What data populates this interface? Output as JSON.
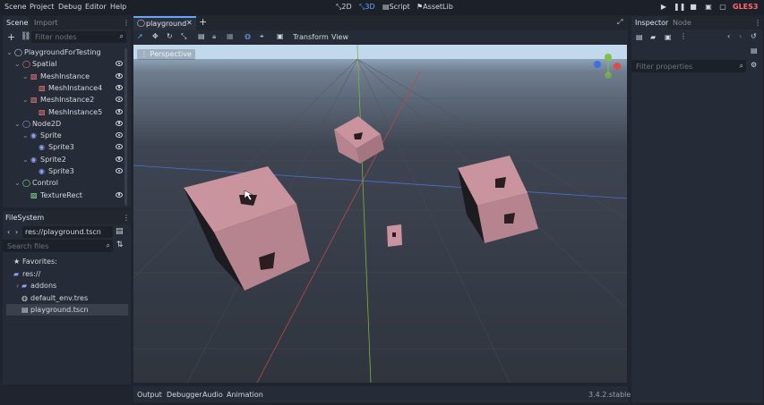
{
  "menu": [
    "Scene",
    "Project",
    "Debug",
    "Editor",
    "Help"
  ],
  "modes": [
    {
      "label": "2D",
      "icon": "2d-icon",
      "active": false
    },
    {
      "label": "3D",
      "icon": "3d-icon",
      "active": true
    },
    {
      "label": "Script",
      "icon": "script-icon",
      "active": false
    },
    {
      "label": "AssetLib",
      "icon": "assetlib-icon",
      "active": false
    }
  ],
  "renderer": "GLES3",
  "scene_dock": {
    "tabs": [
      "Scene",
      "Import"
    ],
    "filter_placeholder": "Filter nodes",
    "tree": [
      {
        "label": "PlaygroundForTesting",
        "depth": 0,
        "icon": "node3d-root-icon",
        "color": "#d4d7dc",
        "eye": false
      },
      {
        "label": "Spatial",
        "depth": 1,
        "icon": "spatial-icon",
        "color": "#fc7f7f",
        "eye": true
      },
      {
        "label": "MeshInstance",
        "depth": 2,
        "icon": "meshinstance-icon",
        "color": "#fc7f7f",
        "eye": true
      },
      {
        "label": "MeshInstance4",
        "depth": 3,
        "icon": "meshinstance-icon",
        "color": "#fc7f7f",
        "eye": true
      },
      {
        "label": "MeshInstance2",
        "depth": 2,
        "icon": "meshinstance-icon",
        "color": "#fc7f7f",
        "eye": true
      },
      {
        "label": "MeshInstance5",
        "depth": 3,
        "icon": "meshinstance-icon",
        "color": "#fc7f7f",
        "eye": true
      },
      {
        "label": "Node2D",
        "depth": 1,
        "icon": "node2d-icon",
        "color": "#8da5f3",
        "eye": true
      },
      {
        "label": "Sprite",
        "depth": 2,
        "icon": "sprite-icon",
        "color": "#8da5f3",
        "eye": true
      },
      {
        "label": "Sprite3",
        "depth": 3,
        "icon": "sprite-icon",
        "color": "#8da5f3",
        "eye": true
      },
      {
        "label": "Sprite2",
        "depth": 2,
        "icon": "sprite-icon",
        "color": "#8da5f3",
        "eye": true
      },
      {
        "label": "Sprite3",
        "depth": 3,
        "icon": "sprite-icon",
        "color": "#8da5f3",
        "eye": true
      },
      {
        "label": "Control",
        "depth": 1,
        "icon": "control-icon",
        "color": "#8eef97",
        "eye": false
      },
      {
        "label": "TextureRect",
        "depth": 2,
        "icon": "texturerect-icon",
        "color": "#8eef97",
        "eye": true
      }
    ]
  },
  "filesystem": {
    "title": "FileSystem",
    "path": "res://playground.tscn",
    "search_placeholder": "Search files",
    "items": [
      {
        "label": "Favorites:",
        "depth": 0,
        "icon": "star-icon"
      },
      {
        "label": "res://",
        "depth": 0,
        "icon": "folder-icon"
      },
      {
        "label": "addons",
        "depth": 1,
        "icon": "folder-icon"
      },
      {
        "label": "default_env.tres",
        "depth": 1,
        "icon": "environment-icon"
      },
      {
        "label": "playground.tscn",
        "depth": 1,
        "icon": "scene-file-icon",
        "selected": true
      }
    ]
  },
  "editor_tab": "playground",
  "toolbar": {
    "transform": "Transform",
    "view": "View"
  },
  "viewport": {
    "label": "Perspective"
  },
  "bottom_tabs": [
    "Output",
    "Debugger",
    "Audio",
    "Animation"
  ],
  "version": "3.4.2.stable",
  "inspector": {
    "tabs": [
      "Inspector",
      "Node"
    ],
    "filter_placeholder": "Filter properties"
  }
}
